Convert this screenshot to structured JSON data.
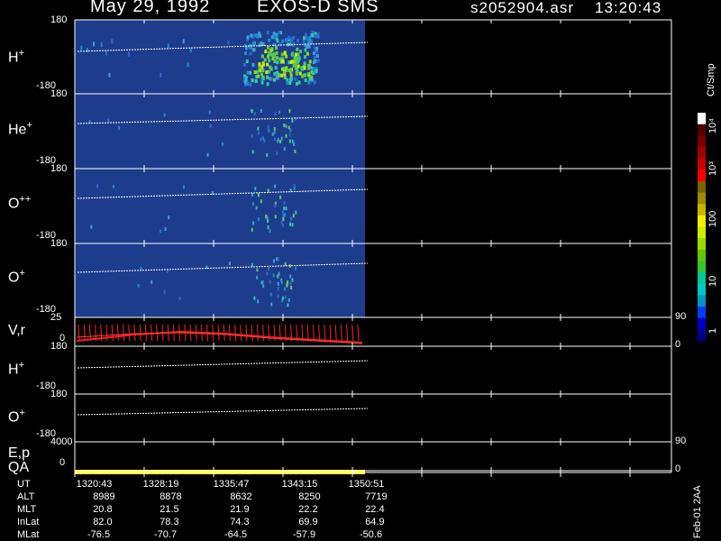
{
  "header": {
    "date": "May 29, 1992",
    "instrument": "EXOS-D SMS",
    "file": "s2052904.asr",
    "time": "13:20:43"
  },
  "panels": [
    {
      "id": "h-plus",
      "species": "H",
      "charge": "+",
      "top": "180",
      "bottom": "-180"
    },
    {
      "id": "he-plus",
      "species": "He",
      "charge": "+",
      "top": "180",
      "bottom": "-180"
    },
    {
      "id": "o-plusplus",
      "species": "O",
      "charge": "++",
      "top": "180",
      "bottom": "-180"
    },
    {
      "id": "o-plus",
      "species": "O",
      "charge": "+",
      "top": "180",
      "bottom": "-180"
    },
    {
      "id": "vr",
      "species": "V,r",
      "charge": "",
      "top": "25",
      "bottom": "0",
      "right_top": "90",
      "right_bottom": "0"
    },
    {
      "id": "h-plus-pa",
      "species": "H",
      "charge": "+",
      "top": "180",
      "bottom": "-180"
    },
    {
      "id": "o-plus-pa",
      "species": "O",
      "charge": "+",
      "top": "180",
      "bottom": "-180"
    },
    {
      "id": "ep",
      "species": "E,p",
      "charge": "",
      "top": "4000",
      "bottom": "0",
      "right_top": "90",
      "right_bottom": "0"
    },
    {
      "id": "qa",
      "species": "QA",
      "charge": ""
    }
  ],
  "colorbar": {
    "unit": "Ct/Smp",
    "ticks": [
      "1",
      "10",
      "100",
      "10³",
      "10⁴"
    ],
    "colors": [
      "#00008b",
      "#0000c8",
      "#003cff",
      "#0096c8",
      "#00c8c8",
      "#00c896",
      "#32c832",
      "#64c800",
      "#96dc00",
      "#c8f000",
      "#f0f000",
      "#c8b400",
      "#a08c00",
      "#786400",
      "#ff0000",
      "#c80000",
      "#a00000",
      "#780000",
      "#500000",
      "#ffffff"
    ]
  },
  "footer": {
    "row_labels": [
      "UT",
      "ALT",
      "MLT",
      "InLat",
      "MLat"
    ],
    "columns": [
      [
        "1320:43",
        "8989",
        "20.8",
        "82.0",
        "-76.5"
      ],
      [
        "1328:19",
        "8878",
        "21.5",
        "78.3",
        "-70.7"
      ],
      [
        "1335:47",
        "8632",
        "21.9",
        "74.3",
        "-64.5"
      ],
      [
        "1343:15",
        "8250",
        "22.2",
        "69.9",
        "-57.9"
      ],
      [
        "1350:51",
        "7719",
        "22.4",
        "64.9",
        "-50.6"
      ]
    ],
    "stamp": "Feb-01 2AA"
  },
  "chart_data": {
    "type": "heatmap",
    "x_axis": "UT",
    "x": [
      "1320:43",
      "1328:19",
      "1335:47",
      "1343:15",
      "1350:51"
    ],
    "data_coverage": [
      "1320:43",
      "1350:51"
    ],
    "series": [
      {
        "name": "H+",
        "y_range": [
          -180,
          180
        ],
        "peak_counts_region": [
          "1335:47",
          "1343:15"
        ]
      },
      {
        "name": "He+",
        "y_range": [
          -180,
          180
        ]
      },
      {
        "name": "O++",
        "y_range": [
          -180,
          180
        ]
      },
      {
        "name": "O+",
        "y_range": [
          -180,
          180
        ]
      }
    ],
    "colorbar_range": [
      1,
      10000
    ],
    "colorbar_scale": "log"
  }
}
